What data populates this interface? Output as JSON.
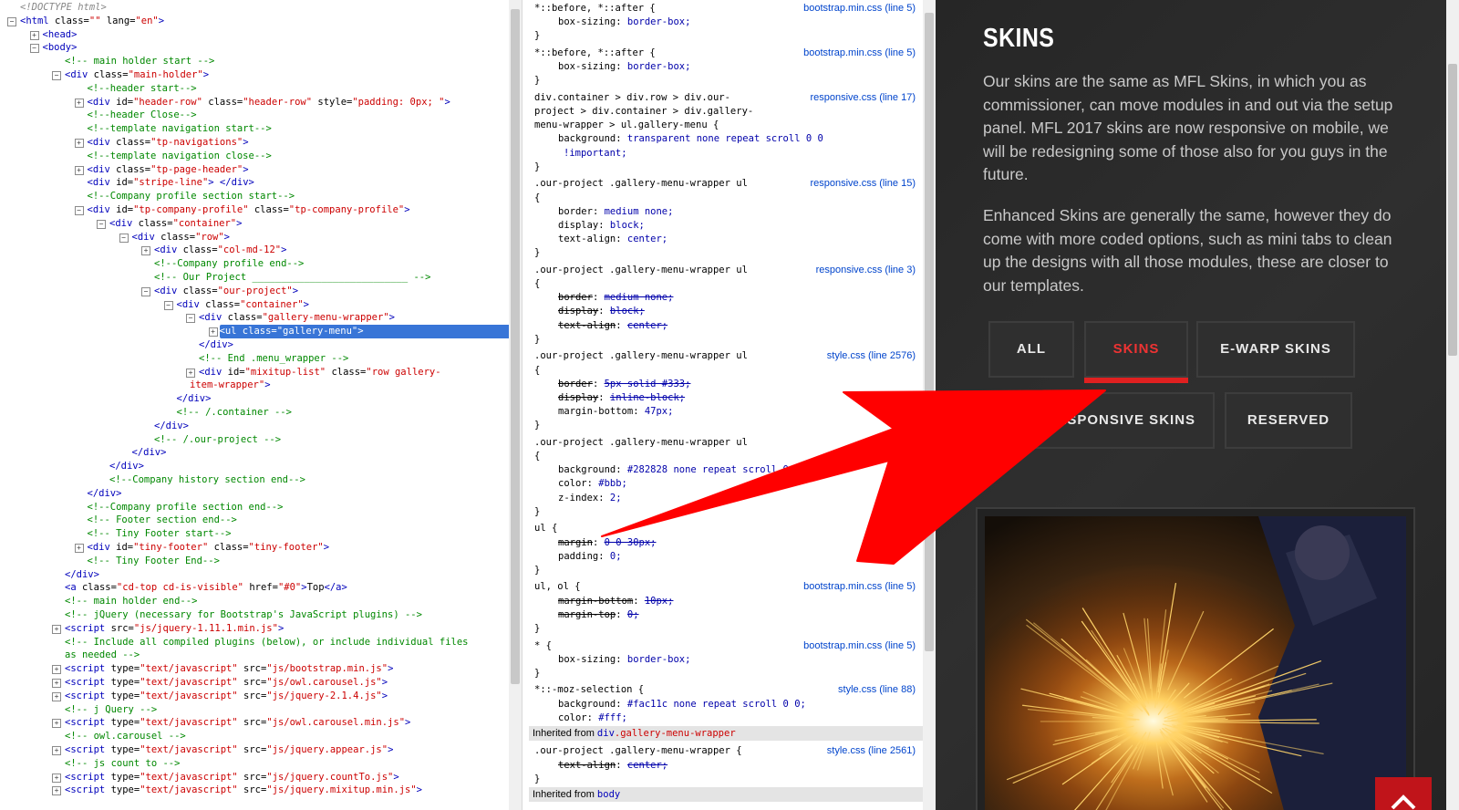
{
  "dom_tree": {
    "lines": [
      {
        "indent": 0,
        "twisty": "",
        "html": "<span class='t-doc'>&lt;!DOCTYPE html&gt;</span>"
      },
      {
        "indent": 0,
        "twisty": "-",
        "html": "<span class='t-tag'>&lt;html</span> <span class='t-attr'>class=</span><span class='t-val'>\"\"</span> <span class='t-attr'>lang=</span><span class='t-val'>\"en\"</span><span class='t-tag'>&gt;</span>"
      },
      {
        "indent": 1,
        "twisty": "+",
        "html": "<span class='t-tag'>&lt;head&gt;</span>"
      },
      {
        "indent": 1,
        "twisty": "-",
        "html": "<span class='t-tag'>&lt;body&gt;</span>"
      },
      {
        "indent": 2,
        "twisty": "",
        "html": "<span class='t-com'>&lt;!-- main holder start --&gt;</span>"
      },
      {
        "indent": 2,
        "twisty": "-",
        "html": "<span class='t-tag'>&lt;div</span> <span class='t-attr'>class=</span><span class='t-val'>\"main-holder\"</span><span class='t-tag'>&gt;</span>"
      },
      {
        "indent": 3,
        "twisty": "",
        "html": "<span class='t-com'>&lt;!--header start--&gt;</span>"
      },
      {
        "indent": 3,
        "twisty": "+",
        "html": "<span class='t-tag'>&lt;div</span> <span class='t-attr'>id=</span><span class='t-val'>\"header-row\"</span> <span class='t-attr'>class=</span><span class='t-val'>\"header-row\"</span> <span class='t-attr'>style=</span><span class='t-val'>\"padding: 0px; \"</span><span class='t-tag'>&gt;</span>"
      },
      {
        "indent": 3,
        "twisty": "",
        "html": "<span class='t-com'>&lt;!--header Close--&gt;</span>"
      },
      {
        "indent": 3,
        "twisty": "",
        "html": "<span class='t-com'>&lt;!--template navigation start--&gt;</span>"
      },
      {
        "indent": 3,
        "twisty": "+",
        "html": "<span class='t-tag'>&lt;div</span> <span class='t-attr'>class=</span><span class='t-val'>\"tp-navigations\"</span><span class='t-tag'>&gt;</span>"
      },
      {
        "indent": 3,
        "twisty": "",
        "html": "<span class='t-com'>&lt;!--template navigation close--&gt;</span>"
      },
      {
        "indent": 3,
        "twisty": "+",
        "html": "<span class='t-tag'>&lt;div</span> <span class='t-attr'>class=</span><span class='t-val'>\"tp-page-header\"</span><span class='t-tag'>&gt;</span>"
      },
      {
        "indent": 3,
        "twisty": "",
        "html": "<span class='t-tag'>&lt;div</span> <span class='t-attr'>id=</span><span class='t-val'>\"stripe-line\"</span><span class='t-tag'>&gt; &lt;/div&gt;</span>"
      },
      {
        "indent": 3,
        "twisty": "",
        "html": "<span class='t-com'>&lt;!--Company profile section start--&gt;</span>"
      },
      {
        "indent": 3,
        "twisty": "-",
        "html": "<span class='t-tag'>&lt;div</span> <span class='t-attr'>id=</span><span class='t-val'>\"tp-company-profile\"</span> <span class='t-attr'>class=</span><span class='t-val'>\"tp-company-profile\"</span><span class='t-tag'>&gt;</span>"
      },
      {
        "indent": 4,
        "twisty": "-",
        "html": "<span class='t-tag'>&lt;div</span> <span class='t-attr'>class=</span><span class='t-val'>\"container\"</span><span class='t-tag'>&gt;</span>"
      },
      {
        "indent": 5,
        "twisty": "-",
        "html": "<span class='t-tag'>&lt;div</span> <span class='t-attr'>class=</span><span class='t-val'>\"row\"</span><span class='t-tag'>&gt;</span>"
      },
      {
        "indent": 6,
        "twisty": "+",
        "html": "<span class='t-tag'>&lt;div</span> <span class='t-attr'>class=</span><span class='t-val'>\"col-md-12\"</span><span class='t-tag'>&gt;</span>"
      },
      {
        "indent": 6,
        "twisty": "",
        "html": "<span class='t-com'>&lt;!--Company profile end--&gt;</span>"
      },
      {
        "indent": 6,
        "twisty": "",
        "html": "<span class='t-com'>&lt;!-- Our Project ___________________________ --&gt;</span>"
      },
      {
        "indent": 6,
        "twisty": "-",
        "html": "<span class='t-tag'>&lt;div</span> <span class='t-attr'>class=</span><span class='t-val'>\"our-project\"</span><span class='t-tag'>&gt;</span>"
      },
      {
        "indent": 7,
        "twisty": "-",
        "html": "<span class='t-tag'>&lt;div</span> <span class='t-attr'>class=</span><span class='t-val'>\"container\"</span><span class='t-tag'>&gt;</span>"
      },
      {
        "indent": 8,
        "twisty": "-",
        "html": "<span class='t-tag'>&lt;div</span> <span class='t-attr'>class=</span><span class='t-val'>\"gallery-menu-wrapper\"</span><span class='t-tag'>&gt;</span>"
      },
      {
        "indent": 9,
        "twisty": "+",
        "selected": true,
        "html": "<span class='t-tag'>&lt;ul</span> <span class='t-attr'>class=</span><span class='t-val'>\"gallery-menu\"</span><span class='t-tag'>&gt;</span>"
      },
      {
        "indent": 8,
        "twisty": "",
        "html": "<span class='t-tag'>&lt;/div&gt;</span>"
      },
      {
        "indent": 8,
        "twisty": "",
        "html": "<span class='t-com'>&lt;!-- End .menu_wrapper --&gt;</span>"
      },
      {
        "indent": 8,
        "twisty": "+",
        "html": "<span class='t-tag'>&lt;div</span> <span class='t-attr'>id=</span><span class='t-val'>\"mixitup-list\"</span> <span class='t-attr'>class=</span><span class='t-val'>\"row gallery-</span>"
      },
      {
        "indent": 8,
        "twisty": "",
        "cont": true,
        "html": "<span class='t-val'>item-wrapper\"</span><span class='t-tag'>&gt;</span>"
      },
      {
        "indent": 7,
        "twisty": "",
        "html": "<span class='t-tag'>&lt;/div&gt;</span>"
      },
      {
        "indent": 7,
        "twisty": "",
        "html": "<span class='t-com'>&lt;!-- /.container --&gt;</span>"
      },
      {
        "indent": 6,
        "twisty": "",
        "html": "<span class='t-tag'>&lt;/div&gt;</span>"
      },
      {
        "indent": 6,
        "twisty": "",
        "html": "<span class='t-com'>&lt;!-- /.our-project --&gt;</span>"
      },
      {
        "indent": 5,
        "twisty": "",
        "html": "<span class='t-tag'>&lt;/div&gt;</span>"
      },
      {
        "indent": 4,
        "twisty": "",
        "html": "<span class='t-tag'>&lt;/div&gt;</span>"
      },
      {
        "indent": 4,
        "twisty": "",
        "html": "<span class='t-com'>&lt;!--Company history section end--&gt;</span>"
      },
      {
        "indent": 3,
        "twisty": "",
        "html": "<span class='t-tag'>&lt;/div&gt;</span>"
      },
      {
        "indent": 3,
        "twisty": "",
        "html": "<span class='t-com'>&lt;!--Company profile section end--&gt;</span>"
      },
      {
        "indent": 3,
        "twisty": "",
        "html": "<span class='t-com'>&lt;!-- Footer section end--&gt;</span>"
      },
      {
        "indent": 3,
        "twisty": "",
        "html": "<span class='t-com'>&lt;!-- Tiny Footer start--&gt;</span>"
      },
      {
        "indent": 3,
        "twisty": "+",
        "html": "<span class='t-tag'>&lt;div</span> <span class='t-attr'>id=</span><span class='t-val'>\"tiny-footer\"</span> <span class='t-attr'>class=</span><span class='t-val'>\"tiny-footer\"</span><span class='t-tag'>&gt;</span>"
      },
      {
        "indent": 3,
        "twisty": "",
        "html": "<span class='t-com'>&lt;!-- Tiny Footer End--&gt;</span>"
      },
      {
        "indent": 2,
        "twisty": "",
        "html": "<span class='t-tag'>&lt;/div&gt;</span>"
      },
      {
        "indent": 2,
        "twisty": "",
        "html": "<span class='t-tag'>&lt;a</span> <span class='t-attr'>class=</span><span class='t-val'>\"cd-top cd-is-visible\"</span> <span class='t-attr'>href=</span><span class='t-val'>\"#0\"</span><span class='t-tag'>&gt;</span><span class='t-text'>Top</span><span class='t-tag'>&lt;/a&gt;</span>"
      },
      {
        "indent": 2,
        "twisty": "",
        "html": "<span class='t-com'>&lt;!-- main holder end--&gt;</span>"
      },
      {
        "indent": 2,
        "twisty": "",
        "html": "<span class='t-com'>&lt;!-- jQuery (necessary for Bootstrap's JavaScript plugins) --&gt;</span>"
      },
      {
        "indent": 2,
        "twisty": "+",
        "html": "<span class='t-tag'>&lt;script</span> <span class='t-attr'>src=</span><span class='t-val'>\"js/jquery-1.11.1.min.js\"</span><span class='t-tag'>&gt;</span>"
      },
      {
        "indent": 2,
        "twisty": "",
        "html": "<span class='t-com'>&lt;!-- Include all compiled plugins (below), or include individual files</span>"
      },
      {
        "indent": 2,
        "twisty": "",
        "html": "<span class='t-com'>as needed --&gt;</span>"
      },
      {
        "indent": 2,
        "twisty": "+",
        "html": "<span class='t-tag'>&lt;script</span> <span class='t-attr'>type=</span><span class='t-val'>\"text/javascript\"</span> <span class='t-attr'>src=</span><span class='t-val'>\"js/bootstrap.min.js\"</span><span class='t-tag'>&gt;</span>"
      },
      {
        "indent": 2,
        "twisty": "+",
        "html": "<span class='t-tag'>&lt;script</span> <span class='t-attr'>type=</span><span class='t-val'>\"text/javascript\"</span> <span class='t-attr'>src=</span><span class='t-val'>\"js/owl.carousel.js\"</span><span class='t-tag'>&gt;</span>"
      },
      {
        "indent": 2,
        "twisty": "+",
        "html": "<span class='t-tag'>&lt;script</span> <span class='t-attr'>type=</span><span class='t-val'>\"text/javascript\"</span> <span class='t-attr'>src=</span><span class='t-val'>\"js/jquery-2.1.4.js\"</span><span class='t-tag'>&gt;</span>"
      },
      {
        "indent": 2,
        "twisty": "",
        "html": "<span class='t-com'>&lt;!-- j Query --&gt;</span>"
      },
      {
        "indent": 2,
        "twisty": "+",
        "html": "<span class='t-tag'>&lt;script</span> <span class='t-attr'>type=</span><span class='t-val'>\"text/javascript\"</span> <span class='t-attr'>src=</span><span class='t-val'>\"js/owl.carousel.min.js\"</span><span class='t-tag'>&gt;</span>"
      },
      {
        "indent": 2,
        "twisty": "",
        "html": "<span class='t-com'>&lt;!-- owl.carousel --&gt;</span>"
      },
      {
        "indent": 2,
        "twisty": "+",
        "html": "<span class='t-tag'>&lt;script</span> <span class='t-attr'>type=</span><span class='t-val'>\"text/javascript\"</span> <span class='t-attr'>src=</span><span class='t-val'>\"js/jquery.appear.js\"</span><span class='t-tag'>&gt;</span>"
      },
      {
        "indent": 2,
        "twisty": "",
        "html": "<span class='t-com'>&lt;!-- js count to --&gt;</span>"
      },
      {
        "indent": 2,
        "twisty": "+",
        "html": "<span class='t-tag'>&lt;script</span> <span class='t-attr'>type=</span><span class='t-val'>\"text/javascript\"</span> <span class='t-attr'>src=</span><span class='t-val'>\"js/jquery.countTo.js\"</span><span class='t-tag'>&gt;</span>"
      },
      {
        "indent": 2,
        "twisty": "+",
        "html": "<span class='t-tag'>&lt;script</span> <span class='t-attr'>type=</span><span class='t-val'>\"text/javascript\"</span> <span class='t-attr'>src=</span><span class='t-val'>\"js/jquery.mixitup.min.js\"</span><span class='t-tag'>&gt;</span>"
      }
    ]
  },
  "css_rules": {
    "rows": [
      {
        "kind": "sel",
        "text": "*::before, *::after {",
        "src": "bootstrap.min.css (line 5)"
      },
      {
        "kind": "decl",
        "prop": "box-sizing",
        "val": "border-box;"
      },
      {
        "kind": "close",
        "text": "}"
      },
      {
        "kind": "gap"
      },
      {
        "kind": "sel",
        "text": "*::before, *::after {",
        "src": "bootstrap.min.css (line 5)"
      },
      {
        "kind": "decl",
        "prop": "box-sizing",
        "val": "border-box;"
      },
      {
        "kind": "close",
        "text": "}"
      },
      {
        "kind": "gap"
      },
      {
        "kind": "sel",
        "text": "div.container > div.row > div.our-",
        "src": "responsive.css (line 17)"
      },
      {
        "kind": "sel",
        "text": "project > div.container > div.gallery-"
      },
      {
        "kind": "sel",
        "text": "menu-wrapper > ul.gallery-menu {"
      },
      {
        "kind": "decl",
        "prop": "background",
        "val": "transparent none repeat scroll 0 0"
      },
      {
        "kind": "decl2",
        "val": "!important;"
      },
      {
        "kind": "close",
        "text": "}"
      },
      {
        "kind": "gap"
      },
      {
        "kind": "sel",
        "text": ".our-project .gallery-menu-wrapper ul",
        "src": "responsive.css (line 15)"
      },
      {
        "kind": "close",
        "text": "{"
      },
      {
        "kind": "decl",
        "prop": "border",
        "val": "medium none;"
      },
      {
        "kind": "decl",
        "prop": "display",
        "val": "block;"
      },
      {
        "kind": "decl",
        "prop": "text-align",
        "val": "center;"
      },
      {
        "kind": "close",
        "text": "}"
      },
      {
        "kind": "gap"
      },
      {
        "kind": "sel",
        "text": ".our-project .gallery-menu-wrapper ul",
        "src": "responsive.css (line 3)"
      },
      {
        "kind": "close",
        "text": "{"
      },
      {
        "kind": "decl",
        "prop": "border",
        "val": "medium none;",
        "struck": true
      },
      {
        "kind": "decl",
        "prop": "display",
        "val": "block;",
        "struck": true
      },
      {
        "kind": "decl",
        "prop": "text-align",
        "val": "center;",
        "struck": true
      },
      {
        "kind": "close",
        "text": "}"
      },
      {
        "kind": "gap"
      },
      {
        "kind": "sel",
        "text": ".our-project .gallery-menu-wrapper ul",
        "src": "style.css (line 2576)"
      },
      {
        "kind": "close",
        "text": "{"
      },
      {
        "kind": "decl",
        "prop": "border",
        "val": "5px solid #333;",
        "struck": true
      },
      {
        "kind": "decl",
        "prop": "display",
        "val": "inline-block;",
        "struck": true
      },
      {
        "kind": "decl",
        "prop": "margin-bottom",
        "val": "47px;"
      },
      {
        "kind": "close",
        "text": "}"
      },
      {
        "kind": "gap"
      },
      {
        "kind": "sel",
        "text": ".our-project .gallery-menu-wrapper ul",
        "src": "sty"
      },
      {
        "kind": "close",
        "text": "{"
      },
      {
        "kind": "decl",
        "prop": "background",
        "val": "#282828 none repeat scroll 0 0;"
      },
      {
        "kind": "decl",
        "prop": "color",
        "val": "#bbb;"
      },
      {
        "kind": "decl",
        "prop": "z-index",
        "val": "2;"
      },
      {
        "kind": "close",
        "text": "}"
      },
      {
        "kind": "gap"
      },
      {
        "kind": "sel",
        "text": "ul {",
        "src": "style.css"
      },
      {
        "kind": "decl",
        "prop": "margin",
        "val": "0 0 30px;",
        "struck": true
      },
      {
        "kind": "decl",
        "prop": "padding",
        "val": "0;"
      },
      {
        "kind": "close",
        "text": "}"
      },
      {
        "kind": "gap"
      },
      {
        "kind": "sel",
        "text": "ul, ol {",
        "src": "bootstrap.min.css (line 5)"
      },
      {
        "kind": "decl",
        "prop": "margin-bottom",
        "val": "10px;",
        "struck": true
      },
      {
        "kind": "decl",
        "prop": "margin-top",
        "val": "0;",
        "struck": true
      },
      {
        "kind": "close",
        "text": "}"
      },
      {
        "kind": "gap"
      },
      {
        "kind": "sel",
        "text": "* {",
        "src": "bootstrap.min.css (line 5)"
      },
      {
        "kind": "decl",
        "prop": "box-sizing",
        "val": "border-box;"
      },
      {
        "kind": "close",
        "text": "}"
      },
      {
        "kind": "gap"
      },
      {
        "kind": "sel",
        "text": "*::-moz-selection {",
        "src": "style.css (line 88)"
      },
      {
        "kind": "decl",
        "prop": "background",
        "val": "#fac11c none repeat scroll 0 0;"
      },
      {
        "kind": "decl",
        "prop": "color",
        "val": "#fff;"
      },
      {
        "kind": "inherit",
        "label": "Inherited from",
        "sel": "div",
        "selr": ".gallery-menu-wrapper"
      },
      {
        "kind": "gap"
      },
      {
        "kind": "sel",
        "text": ".our-project .gallery-menu-wrapper {",
        "src": "style.css (line 2561)"
      },
      {
        "kind": "decl",
        "prop": "text-align",
        "val": "center;",
        "struck": true
      },
      {
        "kind": "close",
        "text": "}"
      },
      {
        "kind": "inherit",
        "label": "Inherited from",
        "sel": "body",
        "selr": ""
      }
    ]
  },
  "site": {
    "title": "SKINS",
    "para1": "Our skins are the same as MFL Skins, in which you as commissioner, can move modules in and out via the setup panel. MFL 2017 skins are now responsive on mobile, we will be redesigning some of those also for you guys in the future.",
    "para2": "Enhanced Skins are generally the same, however they do come with more coded options, such as mini tabs to clean up the designs with all those modules, these are closer to our templates.",
    "buttons": {
      "all": "ALL",
      "skins": "SKINS",
      "ewarp": "E-WARP SKINS",
      "responsive": "2017 RESPONSIVE SKINS",
      "reserved": "RESERVED"
    },
    "active_filter": "SKINS",
    "accent_color": "#e02020",
    "photo_icon": "welding-sparks-photo",
    "to_top_icon": "chevron-up-icon"
  },
  "annotation": {
    "arrow_color": "#ff0000",
    "arrow_icon": "red-arrow-icon"
  }
}
